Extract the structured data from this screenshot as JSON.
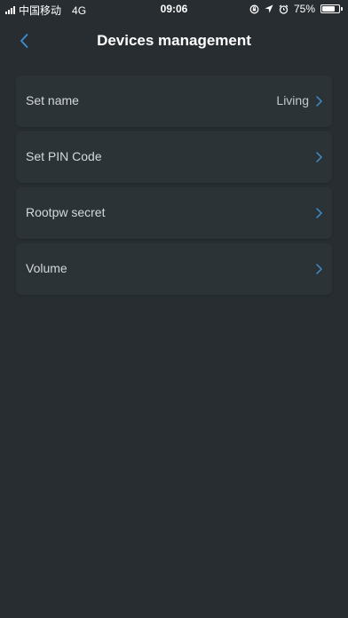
{
  "status_bar": {
    "carrier": "中国移动",
    "network": "4G",
    "time": "09:06",
    "battery": "75%",
    "battery_level": 0.75,
    "icons": [
      "signal-icon",
      "lock-rotation-icon",
      "location-icon",
      "alarm-icon",
      "battery-icon"
    ]
  },
  "header": {
    "title": "Devices management",
    "back_icon": "chevron-left-icon"
  },
  "colors": {
    "background": "#272d31",
    "row_background": "#2c3337",
    "accent": "#3e8ed0"
  },
  "settings": [
    {
      "label": "Set name",
      "value": "Living"
    },
    {
      "label": "Set PIN Code",
      "value": ""
    },
    {
      "label": "Rootpw secret",
      "value": ""
    },
    {
      "label": "Volume",
      "value": ""
    }
  ]
}
